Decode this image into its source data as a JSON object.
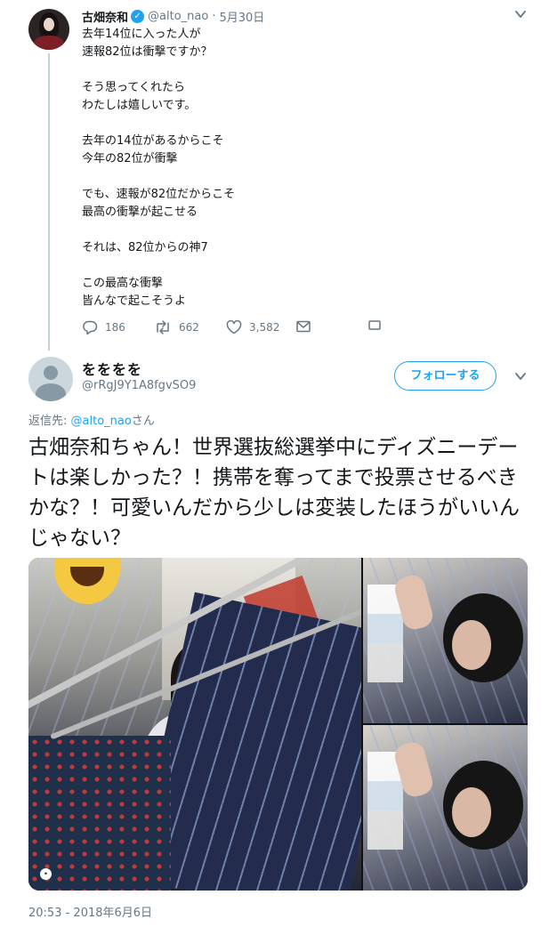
{
  "parent_tweet": {
    "display_name": "古畑奈和",
    "verified_mark": "✓",
    "handle": "@alto_nao",
    "separator": "·",
    "date": "5月30日",
    "text_paragraphs": [
      [
        "去年14位に入った人が",
        "速報82位は衝撃ですか？"
      ],
      [
        "そう思ってくれたら",
        "わたしは嬉しいです。"
      ],
      [
        "去年の14位があるからこそ",
        "今年の82位が衝撃"
      ],
      [
        "でも、速報が82位だからこそ",
        "最高の衝撃が起こせる"
      ],
      [
        "それは、82位からの神7"
      ],
      [
        "この最高な衝撃",
        "皆んなで起こそうよ"
      ]
    ],
    "actions": {
      "reply_count": "186",
      "retweet_count": "662",
      "like_count": "3,582"
    }
  },
  "main_tweet": {
    "display_name": "をををを",
    "handle": "@rRgJ9Y1A8fgvSO9",
    "follow_label": "フォローする",
    "reply_to_prefix": "返信先: ",
    "reply_to_handle": "@alto_nao",
    "reply_to_suffix": "さん",
    "text": "古畑奈和ちゃん！世界選抜総選挙中にディズニーデートは楽しかった？！携帯を奪ってまで投票させるべきかな？！可愛いんだから少しは変装したほうがいいんじゃない？",
    "timestamp": "20:53 - 2018年6月6日"
  },
  "icons": {
    "menu": "chevron-down-icon",
    "reply": "reply-icon",
    "retweet": "retweet-icon",
    "like": "heart-icon",
    "dm": "envelope-icon",
    "more": "more-box-icon"
  },
  "colors": {
    "accent": "#1da1f2",
    "muted": "#657786",
    "text": "#14171a",
    "thread_line": "#c4cfd6"
  }
}
